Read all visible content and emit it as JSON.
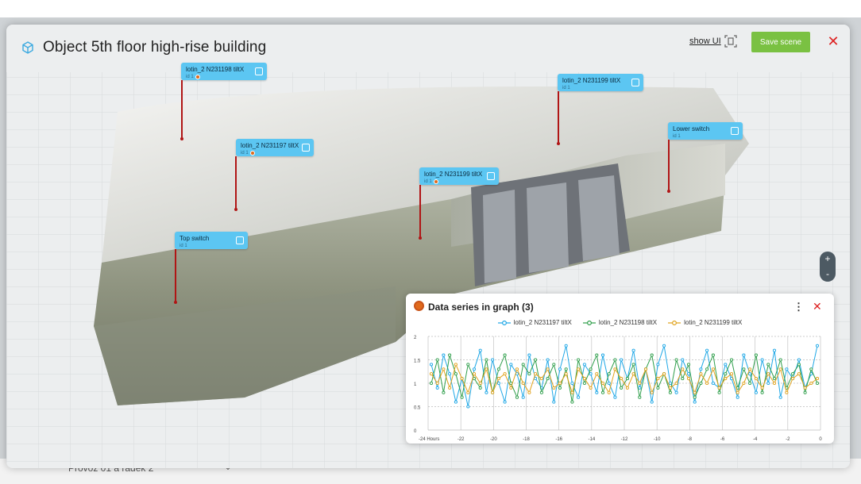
{
  "background": {
    "behind_label": "Provoz 01 a řádek 2"
  },
  "header": {
    "title": "Object 5th floor high-rise building",
    "show_ui": "show UI",
    "save_label": "Save scene",
    "close_icon": "close-icon"
  },
  "sensors": [
    {
      "name": "lotin_2 N231198 tiltX",
      "sub": "id 1",
      "warn": true
    },
    {
      "name": "lotin_2 N231199 tiltX",
      "sub": "id 1",
      "warn": false
    },
    {
      "name": "lotin_2 N231197 tiltX",
      "sub": "id 1",
      "warn": true
    },
    {
      "name": "Lower switch",
      "sub": "id 1",
      "warn": false
    },
    {
      "name": "lotin_2 N231199 tiltX",
      "sub": "id 1",
      "warn": true
    },
    {
      "name": "Top switch",
      "sub": "id 1",
      "warn": false
    }
  ],
  "zoom": {
    "plus": "+",
    "minus": "-"
  },
  "graph": {
    "title": "Data series in graph (3)",
    "menu_icon": "⋮",
    "close_icon": "✕"
  },
  "chart_data": {
    "type": "line",
    "title": "",
    "xlabel": "",
    "ylabel": "",
    "ylim": [
      0,
      2
    ],
    "y_ticks": [
      "0",
      "0.5",
      "1",
      "1.5",
      "2"
    ],
    "x_ticks": [
      "-24 Hours",
      "-22",
      "-20",
      "-18",
      "-16",
      "-14",
      "-12",
      "-10",
      "-8",
      "-6",
      "-4",
      "-2",
      "0"
    ],
    "grid": true,
    "legend_position": "top",
    "series": [
      {
        "name": "lotin_2 N231197 tiltX",
        "color": "#1ea7e6",
        "values": [
          1.4,
          0.9,
          1.6,
          1.2,
          0.6,
          1.1,
          0.5,
          1.3,
          1.7,
          0.8,
          1.5,
          1.0,
          0.6,
          1.4,
          1.2,
          0.7,
          1.6,
          1.1,
          0.9,
          1.5,
          0.6,
          1.3,
          1.8,
          1.0,
          0.7,
          1.4,
          1.2,
          0.8,
          1.6,
          1.0,
          0.7,
          1.5,
          1.1,
          1.7,
          0.9,
          1.3,
          0.6,
          1.4,
          1.8,
          1.0,
          0.8,
          1.5,
          1.2,
          0.6,
          1.3,
          1.7,
          1.0,
          0.9,
          1.4,
          1.1,
          0.7,
          1.6,
          1.2,
          0.8,
          1.5,
          1.0,
          1.7,
          0.7,
          1.3,
          1.1,
          1.5,
          0.9,
          1.2,
          1.8
        ]
      },
      {
        "name": "lotin_2 N231198 tiltX",
        "color": "#2e9e4a",
        "values": [
          1.0,
          1.5,
          0.8,
          1.6,
          1.2,
          0.7,
          1.4,
          1.1,
          0.9,
          1.5,
          0.8,
          1.3,
          1.6,
          1.0,
          0.7,
          1.4,
          1.2,
          1.5,
          0.8,
          1.1,
          1.4,
          0.9,
          1.3,
          0.6,
          1.5,
          1.0,
          1.3,
          1.6,
          0.8,
          1.2,
          1.5,
          0.9,
          1.1,
          1.4,
          0.7,
          1.3,
          1.6,
          0.9,
          1.2,
          0.8,
          1.5,
          1.1,
          1.4,
          0.7,
          1.0,
          1.3,
          1.6,
          0.8,
          1.2,
          1.5,
          0.9,
          1.3,
          1.0,
          1.6,
          0.8,
          1.4,
          1.1,
          1.5,
          0.9,
          1.2,
          1.4,
          0.8,
          1.3,
          1.0
        ]
      },
      {
        "name": "lotin_2 N231199 tiltX",
        "color": "#e0a21c",
        "values": [
          1.2,
          1.0,
          1.3,
          0.9,
          1.4,
          1.1,
          0.8,
          1.2,
          1.0,
          1.3,
          0.8,
          1.1,
          1.2,
          0.9,
          1.3,
          1.0,
          0.8,
          1.2,
          1.1,
          1.3,
          0.9,
          1.0,
          1.2,
          0.8,
          1.3,
          1.1,
          0.9,
          1.2,
          1.0,
          0.8,
          1.3,
          1.1,
          0.9,
          1.2,
          1.0,
          1.3,
          0.8,
          1.1,
          1.2,
          0.9,
          1.0,
          1.3,
          1.1,
          0.8,
          1.2,
          1.0,
          1.3,
          0.9,
          1.1,
          1.2,
          0.8,
          1.0,
          1.3,
          1.1,
          0.9,
          1.2,
          1.0,
          1.3,
          0.8,
          1.1,
          1.2,
          0.9,
          1.0,
          1.1
        ]
      }
    ]
  }
}
